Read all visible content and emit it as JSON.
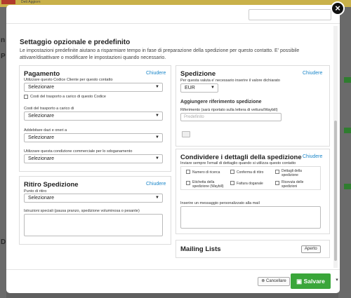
{
  "background": {
    "menu_text": "Dett  Aggiorn",
    "left_chars": [
      "n",
      "P",
      "D"
    ],
    "colors": {
      "brand_yellow": "#c9b14a",
      "brand_red": "#b23b2c"
    }
  },
  "modal": {
    "close_icon": "×",
    "title": "Settaggio opzionale e predefinito",
    "description": "Le impostazioni predefinite aiutano a risparmiare tempo in fase di preparazione della spedizione per questo contatto. E' possibile attivare/disattivare o modificare le impostazioni quando necessario.",
    "pagamento": {
      "title": "Pagamento",
      "close_link": "Chiudere",
      "customer_code_label": "Utilizzare questo Codice Cliente per questo contatto",
      "customer_code_value": "Selezionare",
      "transport_checkbox_label": "Costi del trasporto a carico di questo Codice",
      "transport_cost_label": "Costi del trasporto a carico di",
      "transport_cost_value": "Selezionare",
      "duties_label": "Addebitare dazi e oneri a",
      "duties_value": "Selezionare",
      "customs_label": "Utilizzare questa condizione commerciale per lo sdoganamento",
      "customs_value": "Selezionare"
    },
    "ritiro": {
      "title": "Ritiro Spedizione",
      "close_link": "Chiudere",
      "point_label": "Punto di ritiro",
      "point_value": "Selezionare",
      "instructions_label": "Istruzioni speciali (pausa pranzo, spedizione voluminosa o pesante)"
    },
    "spedizione": {
      "title": "Spedizione",
      "close_link": "Chiudere",
      "currency_label": "Per questa valuta e' necessario inserire il valore dichiarato",
      "currency_value": "EUR",
      "reference_heading": "Aggiungere riferimento spedizione",
      "reference_label": "Riferimento (sarà riportato sulla lettera di vettura/Waybill)",
      "reference_placeholder": "Predefinito"
    },
    "condividere": {
      "title": "Condividere i dettagli della spedizione",
      "close_link": "Chiudere",
      "subtitle": "Inviare sempre l'email di dettaglio quando si utilizza questo contatto",
      "options": [
        "Numero di ricerca",
        "Conferma di ritiro",
        "Dettagli della spedizione",
        "Etichetta della spedizione (Waybill)",
        "Fattura doganale",
        "Ricevuta delle spedizioni"
      ],
      "message_label": "Inserire un messaggio personalizzato alla mail"
    },
    "mailing": {
      "title": "Mailing Lists",
      "badge": "Aperto"
    },
    "footer": {
      "cancel_icon": "⊗",
      "cancel_label": "Cancellare",
      "save_icon": "▣",
      "save_label": "Salvare",
      "dropdown_icon": "▾"
    },
    "colors": {
      "accent_link": "#1a86c9",
      "save_green": "#3aa63a"
    }
  }
}
